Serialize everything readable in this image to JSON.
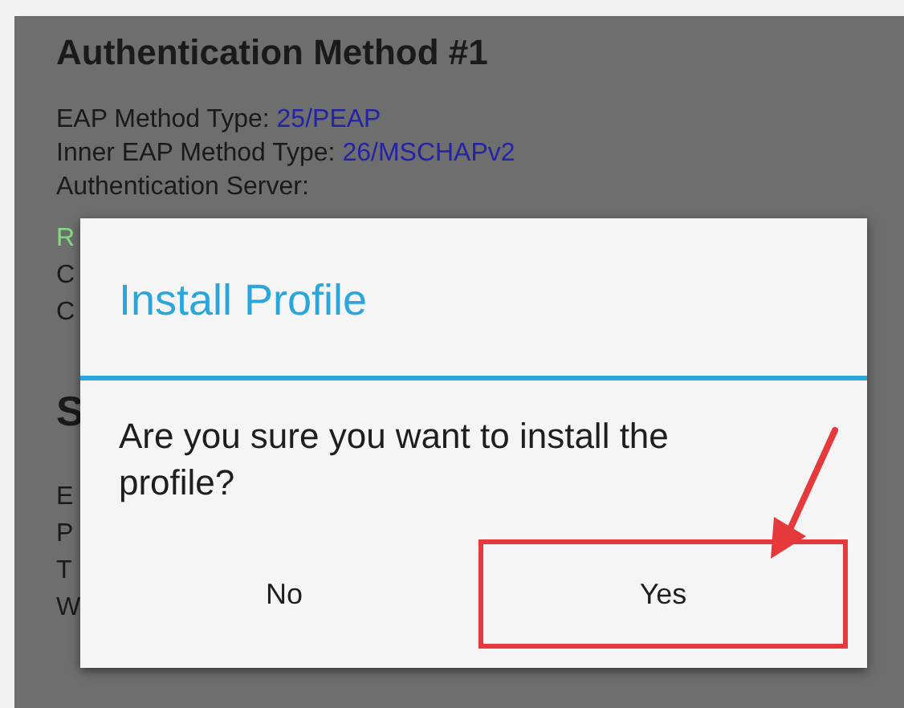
{
  "background": {
    "heading": "Authentication Method #1",
    "fields": [
      {
        "label": "EAP Method Type:",
        "value": "25/PEAP"
      },
      {
        "label": "Inner EAP Method Type:",
        "value": "26/MSCHAPv2"
      }
    ],
    "server_label": "Authentication Server:",
    "covered_lines": [
      {
        "kind": "value",
        "text": "R"
      },
      {
        "kind": "text",
        "text": "C"
      },
      {
        "kind": "text",
        "text": "C"
      },
      {
        "kind": "heading",
        "text": "S"
      },
      {
        "kind": "text",
        "text": "E"
      },
      {
        "kind": "text",
        "text": "P"
      },
      {
        "kind": "text",
        "text": "T"
      },
      {
        "kind": "text",
        "text": "W"
      }
    ]
  },
  "dialog": {
    "title": "Install Profile",
    "message": "Are you sure you want to install the profile?",
    "buttons": [
      {
        "label": "No",
        "highlighted": false
      },
      {
        "label": "Yes",
        "highlighted": true
      }
    ]
  }
}
